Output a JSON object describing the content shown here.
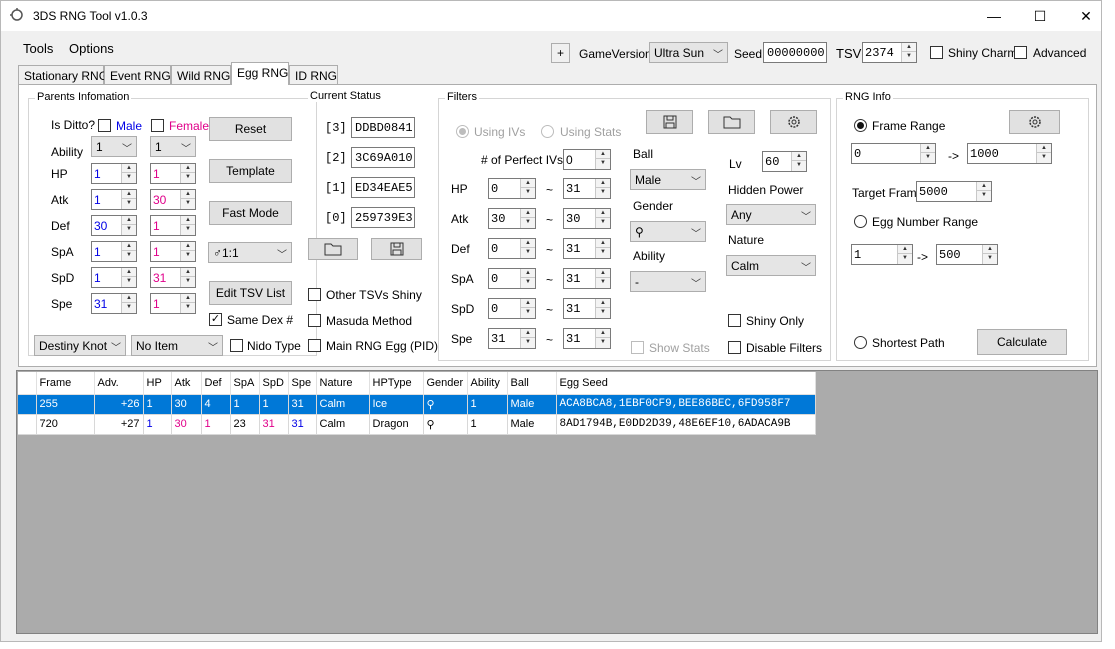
{
  "window": {
    "title": "3DS RNG Tool v1.0.3",
    "minimize": "—",
    "maximize": "☐",
    "close": "✕"
  },
  "menu": {
    "tools": "Tools",
    "options": "Options"
  },
  "header": {
    "plus": "+",
    "game_version_label": "GameVersion",
    "game_version": "Ultra Sun",
    "seed_label": "Seed",
    "seed": "00000000",
    "tsv_label": "TSV",
    "tsv": "2374",
    "shiny_charm": "Shiny Charm",
    "advanced": "Advanced"
  },
  "tabs": [
    "Stationary RNG",
    "Event RNG",
    "Wild RNG",
    "Egg RNG",
    "ID RNG"
  ],
  "parents": {
    "title": "Parents Infomation",
    "is_ditto": "Is Ditto?",
    "male": "Male",
    "female": "Female",
    "ability_label": "Ability",
    "male_ability": "1",
    "female_ability": "1",
    "stats": [
      {
        "label": "HP",
        "male": "1",
        "female": "1"
      },
      {
        "label": "Atk",
        "male": "1",
        "female": "30"
      },
      {
        "label": "Def",
        "male": "30",
        "female": "1"
      },
      {
        "label": "SpA",
        "male": "1",
        "female": "1"
      },
      {
        "label": "SpD",
        "male": "1",
        "female": "31"
      },
      {
        "label": "Spe",
        "male": "31",
        "female": "1"
      }
    ],
    "reset": "Reset",
    "template": "Template",
    "fast_mode": "Fast Mode",
    "gender_ratio": "1:1",
    "edit_tsv": "Edit TSV List",
    "same_dex": "Same Dex #",
    "destiny_knot": "Destiny Knot",
    "no_item": "No Item",
    "nido_type": "Nido Type"
  },
  "status": {
    "title": "Current Status",
    "rows": [
      {
        "label": "[3]",
        "value": "DDBD0841"
      },
      {
        "label": "[2]",
        "value": "3C69A010"
      },
      {
        "label": "[1]",
        "value": "ED34EAE5"
      },
      {
        "label": "[0]",
        "value": "259739E3"
      }
    ],
    "other_tsvs": "Other TSVs Shiny",
    "masuda": "Masuda Method",
    "main_rng_egg": "Main RNG Egg (PID)"
  },
  "filters": {
    "title": "Filters",
    "using_ivs": "Using IVs",
    "using_stats": "Using Stats",
    "perfect_ivs_label": "# of Perfect IVs",
    "perfect_ivs": "0",
    "tilde": "~",
    "ranges": [
      {
        "label": "HP",
        "min": "0",
        "max": "31"
      },
      {
        "label": "Atk",
        "min": "30",
        "max": "30"
      },
      {
        "label": "Def",
        "min": "0",
        "max": "31"
      },
      {
        "label": "SpA",
        "min": "0",
        "max": "31"
      },
      {
        "label": "SpD",
        "min": "0",
        "max": "31"
      },
      {
        "label": "Spe",
        "min": "31",
        "max": "31"
      }
    ],
    "ball_label": "Ball",
    "ball": "Male",
    "gender_label": "Gender",
    "ability_label": "Ability",
    "ability": "-",
    "lv_label": "Lv",
    "lv": "60",
    "hidden_power_label": "Hidden Power",
    "hidden_power": "Any",
    "nature_label": "Nature",
    "nature": "Calm",
    "show_stats": "Show Stats",
    "shiny_only": "Shiny Only",
    "disable_filters": "Disable Filters"
  },
  "rnginfo": {
    "title": "RNG Info",
    "frame_range": "Frame Range",
    "frame_min": "0",
    "frame_max": "1000",
    "arrow": "->",
    "target_frame_label": "Target Frame",
    "target_frame": "5000",
    "egg_number_range": "Egg Number Range",
    "egg_min": "1",
    "egg_max": "500",
    "shortest_path": "Shortest Path",
    "calculate": "Calculate"
  },
  "grid": {
    "columns": [
      "Frame",
      "Adv.",
      "HP",
      "Atk",
      "Def",
      "SpA",
      "SpD",
      "Spe",
      "Nature",
      "HPType",
      "Gender",
      "Ability",
      "Ball",
      "Egg Seed"
    ],
    "rows": [
      {
        "frame": "255",
        "adv": "+26",
        "hp": "1",
        "atk": "30",
        "def": "4",
        "spa": "1",
        "spd": "1",
        "spe": "31",
        "nature": "Calm",
        "hptype": "Ice",
        "ability": "1",
        "ball": "Male",
        "seed": "ACA8BCA8,1EBF0CF9,BEE86BEC,6FD958F7"
      },
      {
        "frame": "720",
        "adv": "+27",
        "hp": "1",
        "atk": "30",
        "def": "1",
        "spa": "23",
        "spd": "31",
        "spe": "31",
        "nature": "Calm",
        "hptype": "Dragon",
        "ability": "1",
        "ball": "Male",
        "seed": "8AD1794B,E0DD2D39,48E6EF10,6ADACA9B"
      }
    ]
  }
}
